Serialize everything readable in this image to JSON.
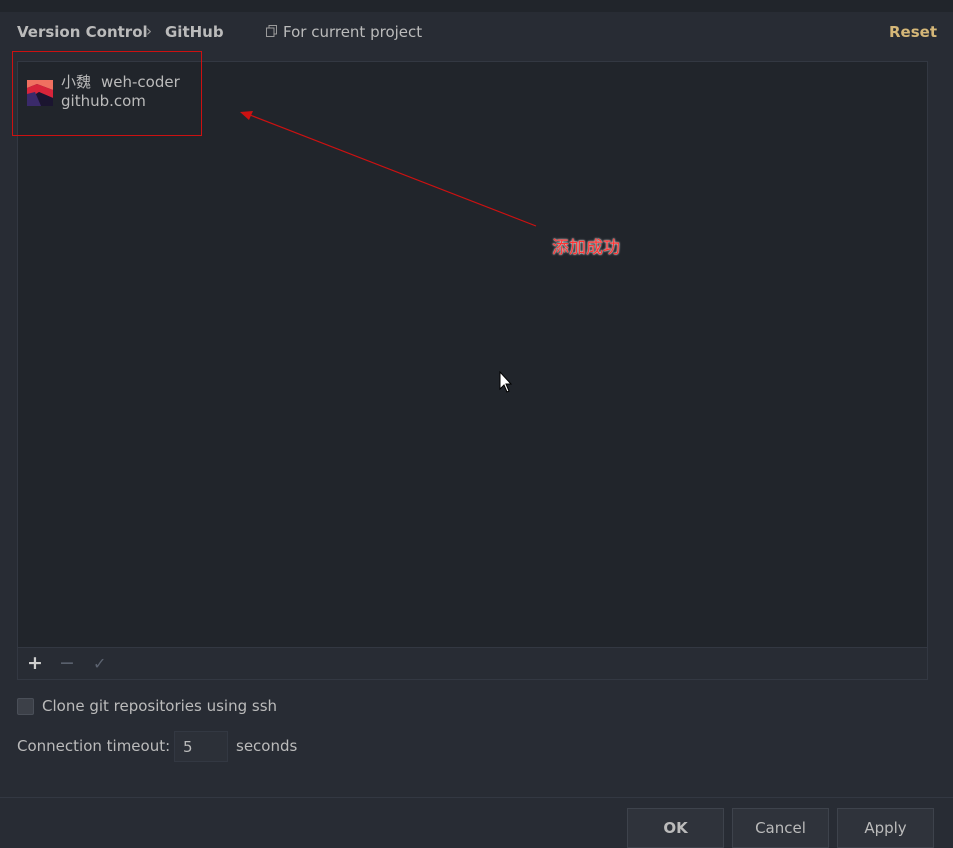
{
  "header": {
    "breadcrumb": [
      "Version Control",
      "GitHub"
    ],
    "breadcrumb_separator": "›",
    "scope_label": "For current project",
    "reset_label": "Reset"
  },
  "accounts": [
    {
      "name": "小魏",
      "login": "weh-coder",
      "server": "github.com"
    }
  ],
  "annotation": {
    "text": "添加成功",
    "color": "#ff2222"
  },
  "toolbar": {
    "add_icon": "+",
    "remove_icon": "−",
    "set_default_icon": "✓"
  },
  "options": {
    "clone_ssh_label": "Clone git repositories using ssh",
    "clone_ssh_checked": false,
    "timeout_label": "Connection timeout:",
    "timeout_value": "5",
    "timeout_unit": "seconds"
  },
  "buttons": {
    "ok": "OK",
    "cancel": "Cancel",
    "apply": "Apply"
  },
  "colors": {
    "background": "#282c34",
    "panel": "#21252b",
    "accent": "#d5b778",
    "highlight": "#cc1111"
  }
}
